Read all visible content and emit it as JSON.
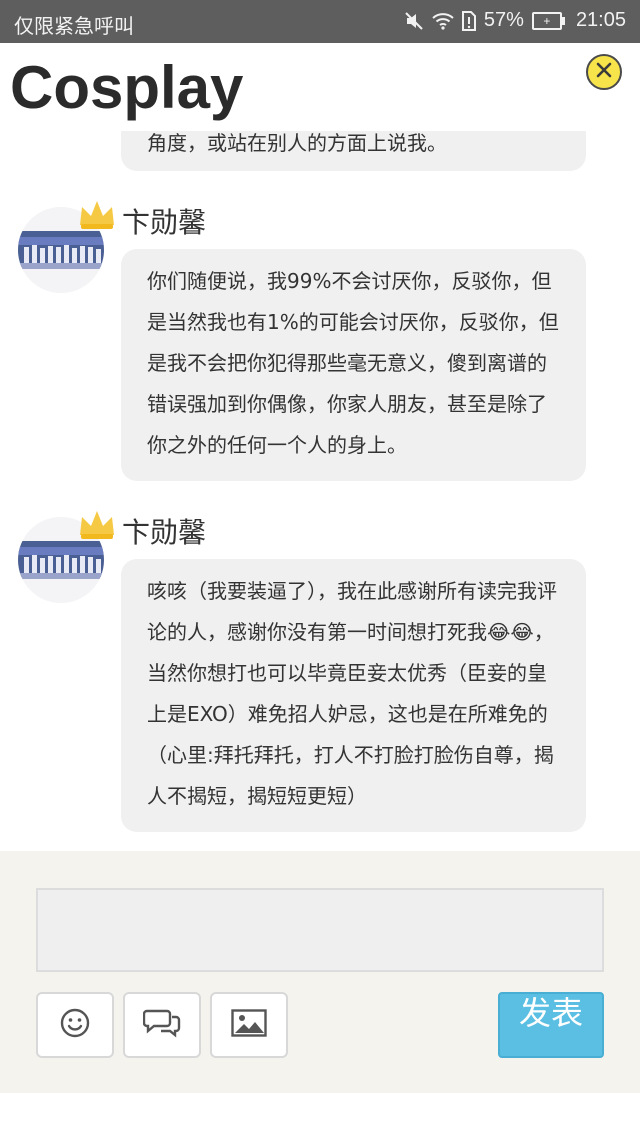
{
  "status_bar": {
    "carrier": "仅限紧急呼叫",
    "battery_percent": "57%",
    "time": "21:05",
    "icons": [
      "mute-icon",
      "wifi-icon",
      "sim-icon",
      "battery-icon"
    ]
  },
  "header": {
    "title": "Cosplay",
    "close_icon": "close-circle-icon",
    "accent_color": "#f7e34a"
  },
  "comments": [
    {
      "text": "角度，或站在别人的方面上说我。"
    },
    {
      "username": "卞勋馨",
      "text": "你们随便说，我99%不会讨厌你，反驳你，但是当然我也有1%的可能会讨厌你，反驳你，但是我不会把你犯得那些毫无意义，傻到离谱的错误强加到你偶像，你家人朋友，甚至是除了你之外的任何一个人的身上。"
    },
    {
      "username": "卞勋馨",
      "text": "咳咳（我要装逼了），我在此感谢所有读完我评论的人，感谢你没有第一时间想打死我😂😂，当然你想打也可以毕竟臣妾太优秀（臣妾的皇上是EXO）难免招人妒忌，这也是在所难免的（心里:拜托拜托，打人不打脸打脸伤自尊，揭人不揭短，揭短短更短）"
    }
  ],
  "composer": {
    "input_value": "",
    "tools": [
      "smiley-icon",
      "chat-bubbles-icon",
      "image-icon"
    ],
    "submit_label": "发表",
    "submit_color": "#5bbfe3"
  }
}
